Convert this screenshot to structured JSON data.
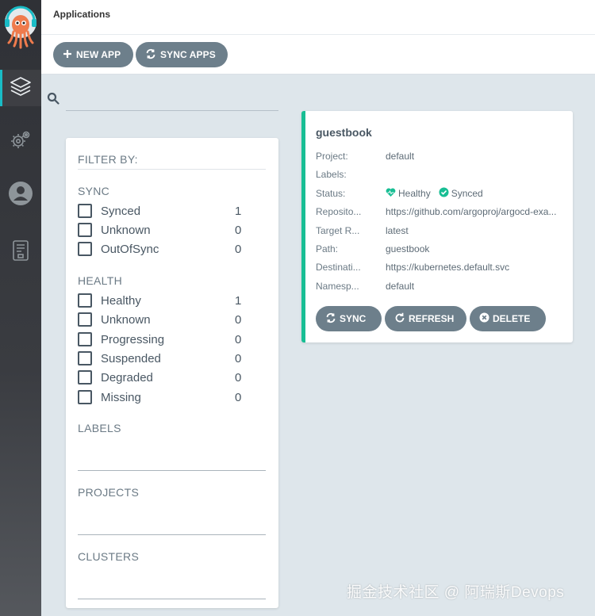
{
  "header": {
    "title": "Applications"
  },
  "toolbar": {
    "new_app_label": "NEW APP",
    "sync_apps_label": "SYNC APPS"
  },
  "search": {
    "value": "",
    "placeholder": ""
  },
  "filter": {
    "title": "FILTER BY:",
    "sync": {
      "title": "SYNC",
      "items": [
        {
          "label": "Synced",
          "count": "1"
        },
        {
          "label": "Unknown",
          "count": "0"
        },
        {
          "label": "OutOfSync",
          "count": "0"
        }
      ]
    },
    "health": {
      "title": "HEALTH",
      "items": [
        {
          "label": "Healthy",
          "count": "1"
        },
        {
          "label": "Unknown",
          "count": "0"
        },
        {
          "label": "Progressing",
          "count": "0"
        },
        {
          "label": "Suspended",
          "count": "0"
        },
        {
          "label": "Degraded",
          "count": "0"
        },
        {
          "label": "Missing",
          "count": "0"
        }
      ]
    },
    "labels_title": "LABELS",
    "projects_title": "PROJECTS",
    "clusters_title": "CLUSTERS"
  },
  "app": {
    "name": "guestbook",
    "props": [
      {
        "key": "Project:",
        "value": "default"
      },
      {
        "key": "Labels:",
        "value": ""
      },
      {
        "key": "Status:",
        "value": ""
      },
      {
        "key": "Reposito...",
        "value": "https://github.com/argoproj/argocd-exa..."
      },
      {
        "key": "Target R...",
        "value": "latest"
      },
      {
        "key": "Path:",
        "value": "guestbook"
      },
      {
        "key": "Destinati...",
        "value": "https://kubernetes.default.svc"
      },
      {
        "key": "Namesp...",
        "value": "default"
      }
    ],
    "health_status": "Healthy",
    "sync_status": "Synced",
    "buttons": {
      "sync": "SYNC",
      "refresh": "REFRESH",
      "delete": "DELETE"
    }
  },
  "colors": {
    "accent": "#18be94",
    "button": "#6d7f8b",
    "sidebar": "#2f3136",
    "nav_active": "#19bcc6"
  },
  "icons": [
    "argo-logo",
    "applications-icon",
    "settings-icon",
    "user-icon",
    "docs-icon",
    "search-icon",
    "plus-icon",
    "sync-icon",
    "refresh-icon",
    "delete-icon",
    "heart-icon",
    "check-circle-icon"
  ],
  "watermark": "掘金技术社区 @ 阿瑞斯Devops"
}
